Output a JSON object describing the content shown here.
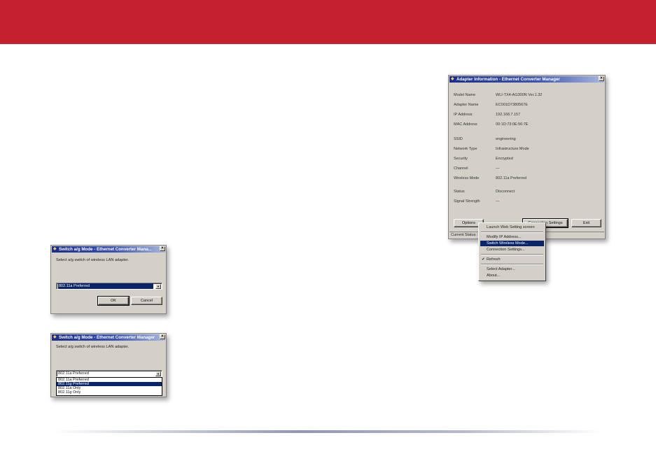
{
  "colors": {
    "banner": "#c4202f",
    "title_bar": "#1a2d8a",
    "dialog_face": "#d4d0c8",
    "selection": "#0a246a"
  },
  "dialog1": {
    "title": "Switch a/g Mode - Ethernet Converter Mana...",
    "prompt": "Select a/g switch of wireless LAN adapter.",
    "selected_value": "802.11a Preferred",
    "ok_label": "OK",
    "cancel_label": "Cancel"
  },
  "dialog2": {
    "title": "Switch a/g Mode - Ethernet Converter Manager",
    "prompt": "Select a/g switch of wireless LAN adapter.",
    "selected_value": "802.11a Preferred",
    "options": [
      {
        "label": "802.11a Preferred",
        "selected": false
      },
      {
        "label": "802.11g Preferred",
        "selected": true
      },
      {
        "label": "802.11a Only",
        "selected": false
      },
      {
        "label": "802.11g Only",
        "selected": false
      }
    ]
  },
  "adapter_window": {
    "title": "Adapter Information - Ethernet Converter Manager",
    "rows": [
      {
        "label": "Model Name",
        "value": "WLI-TX4-AG300N Ver.1.32"
      },
      {
        "label": "Adapter Name",
        "value": "EC001D7380567E"
      },
      {
        "label": "IP Address",
        "value": "192.168.7.157"
      },
      {
        "label": "MAC Address",
        "value": "00:1D:73:0E:56:7E"
      },
      {
        "label": "SSID",
        "value": "engineering"
      },
      {
        "label": "Network Type",
        "value": "Infrastructure Mode"
      },
      {
        "label": "Security",
        "value": "Encrypted"
      },
      {
        "label": "Channel",
        "value": "---"
      },
      {
        "label": "Wireless Mode",
        "value": "802.11a Preferred"
      },
      {
        "label": "Status",
        "value": "Disconnect"
      },
      {
        "label": "Signal Strength",
        "value": "---"
      }
    ],
    "options_label": "Options",
    "connection_settings_label": "Connection Settings",
    "exit_label": "Exit",
    "status_bar": "Current Status :"
  },
  "context_menu": {
    "items": [
      {
        "label": "Launch Web Setting screen",
        "checked": false,
        "selected": false
      },
      {
        "label": "Modify IP Address...",
        "checked": false,
        "selected": false
      },
      {
        "label": "Switch Wireless Mode...",
        "checked": false,
        "selected": true
      },
      {
        "label": "Connection Settings...",
        "checked": false,
        "selected": false
      },
      {
        "label": "Refresh",
        "checked": true,
        "selected": false
      },
      {
        "label": "Select Adapter...",
        "checked": false,
        "selected": false
      },
      {
        "label": "About...",
        "checked": false,
        "selected": false
      }
    ]
  }
}
